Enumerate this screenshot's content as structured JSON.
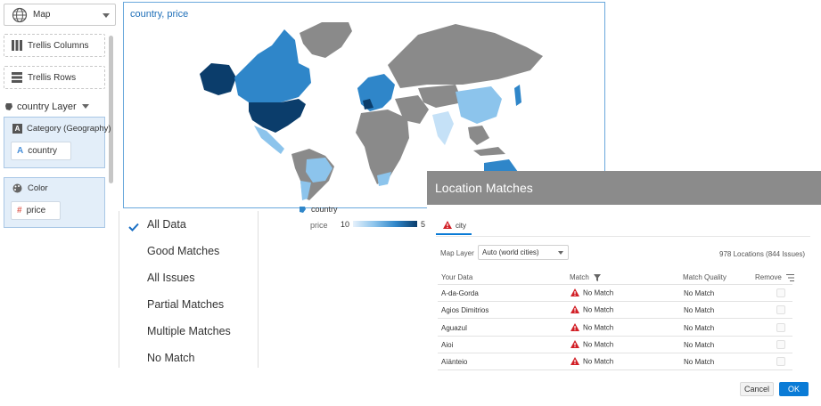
{
  "viz_type": {
    "label": "Map",
    "icon": "globe-icon"
  },
  "trellis": {
    "columns_label": "Trellis Columns",
    "rows_label": "Trellis Rows"
  },
  "layer": {
    "label": "country Layer"
  },
  "category": {
    "title": "Category (Geography)",
    "pill": "country"
  },
  "color": {
    "title": "Color",
    "pill": "price"
  },
  "map": {
    "title": "country, price",
    "legend_layer": "country",
    "legend_measure": "price",
    "legend_min": "10",
    "legend_max": "5",
    "colors": {
      "dark": "#0b3d6b",
      "mid": "#2f86c9",
      "light": "#8cc4ec",
      "pale": "#c5e1f7",
      "gray": "#8a8a8a"
    }
  },
  "filter_menu": {
    "selected": "All Data",
    "items": [
      "All Data",
      "Good Matches",
      "All Issues",
      "Partial Matches",
      "Multiple Matches",
      "No Match"
    ]
  },
  "dialog": {
    "title": "Location Matches",
    "tab_label": "city",
    "map_layer_label": "Map Layer",
    "map_layer_value": "Auto (world cities)",
    "summary": "978 Locations (844 Issues)",
    "columns": {
      "your_data": "Your Data",
      "match": "Match",
      "match_quality": "Match Quality",
      "remove": "Remove"
    },
    "rows": [
      {
        "your_data": "A-da-Gorda",
        "match": "No Match",
        "match_quality": "No Match"
      },
      {
        "your_data": "Agios Dimitrios",
        "match": "No Match",
        "match_quality": "No Match"
      },
      {
        "your_data": "Aguazul",
        "match": "No Match",
        "match_quality": "No Match"
      },
      {
        "your_data": "Aioi",
        "match": "No Match",
        "match_quality": "No Match"
      },
      {
        "your_data": "Aïánteio",
        "match": "No Match",
        "match_quality": "No Match"
      }
    ],
    "cancel_label": "Cancel",
    "ok_label": "OK",
    "accent": "#0a7bd6",
    "warning_color": "#d21f26"
  }
}
